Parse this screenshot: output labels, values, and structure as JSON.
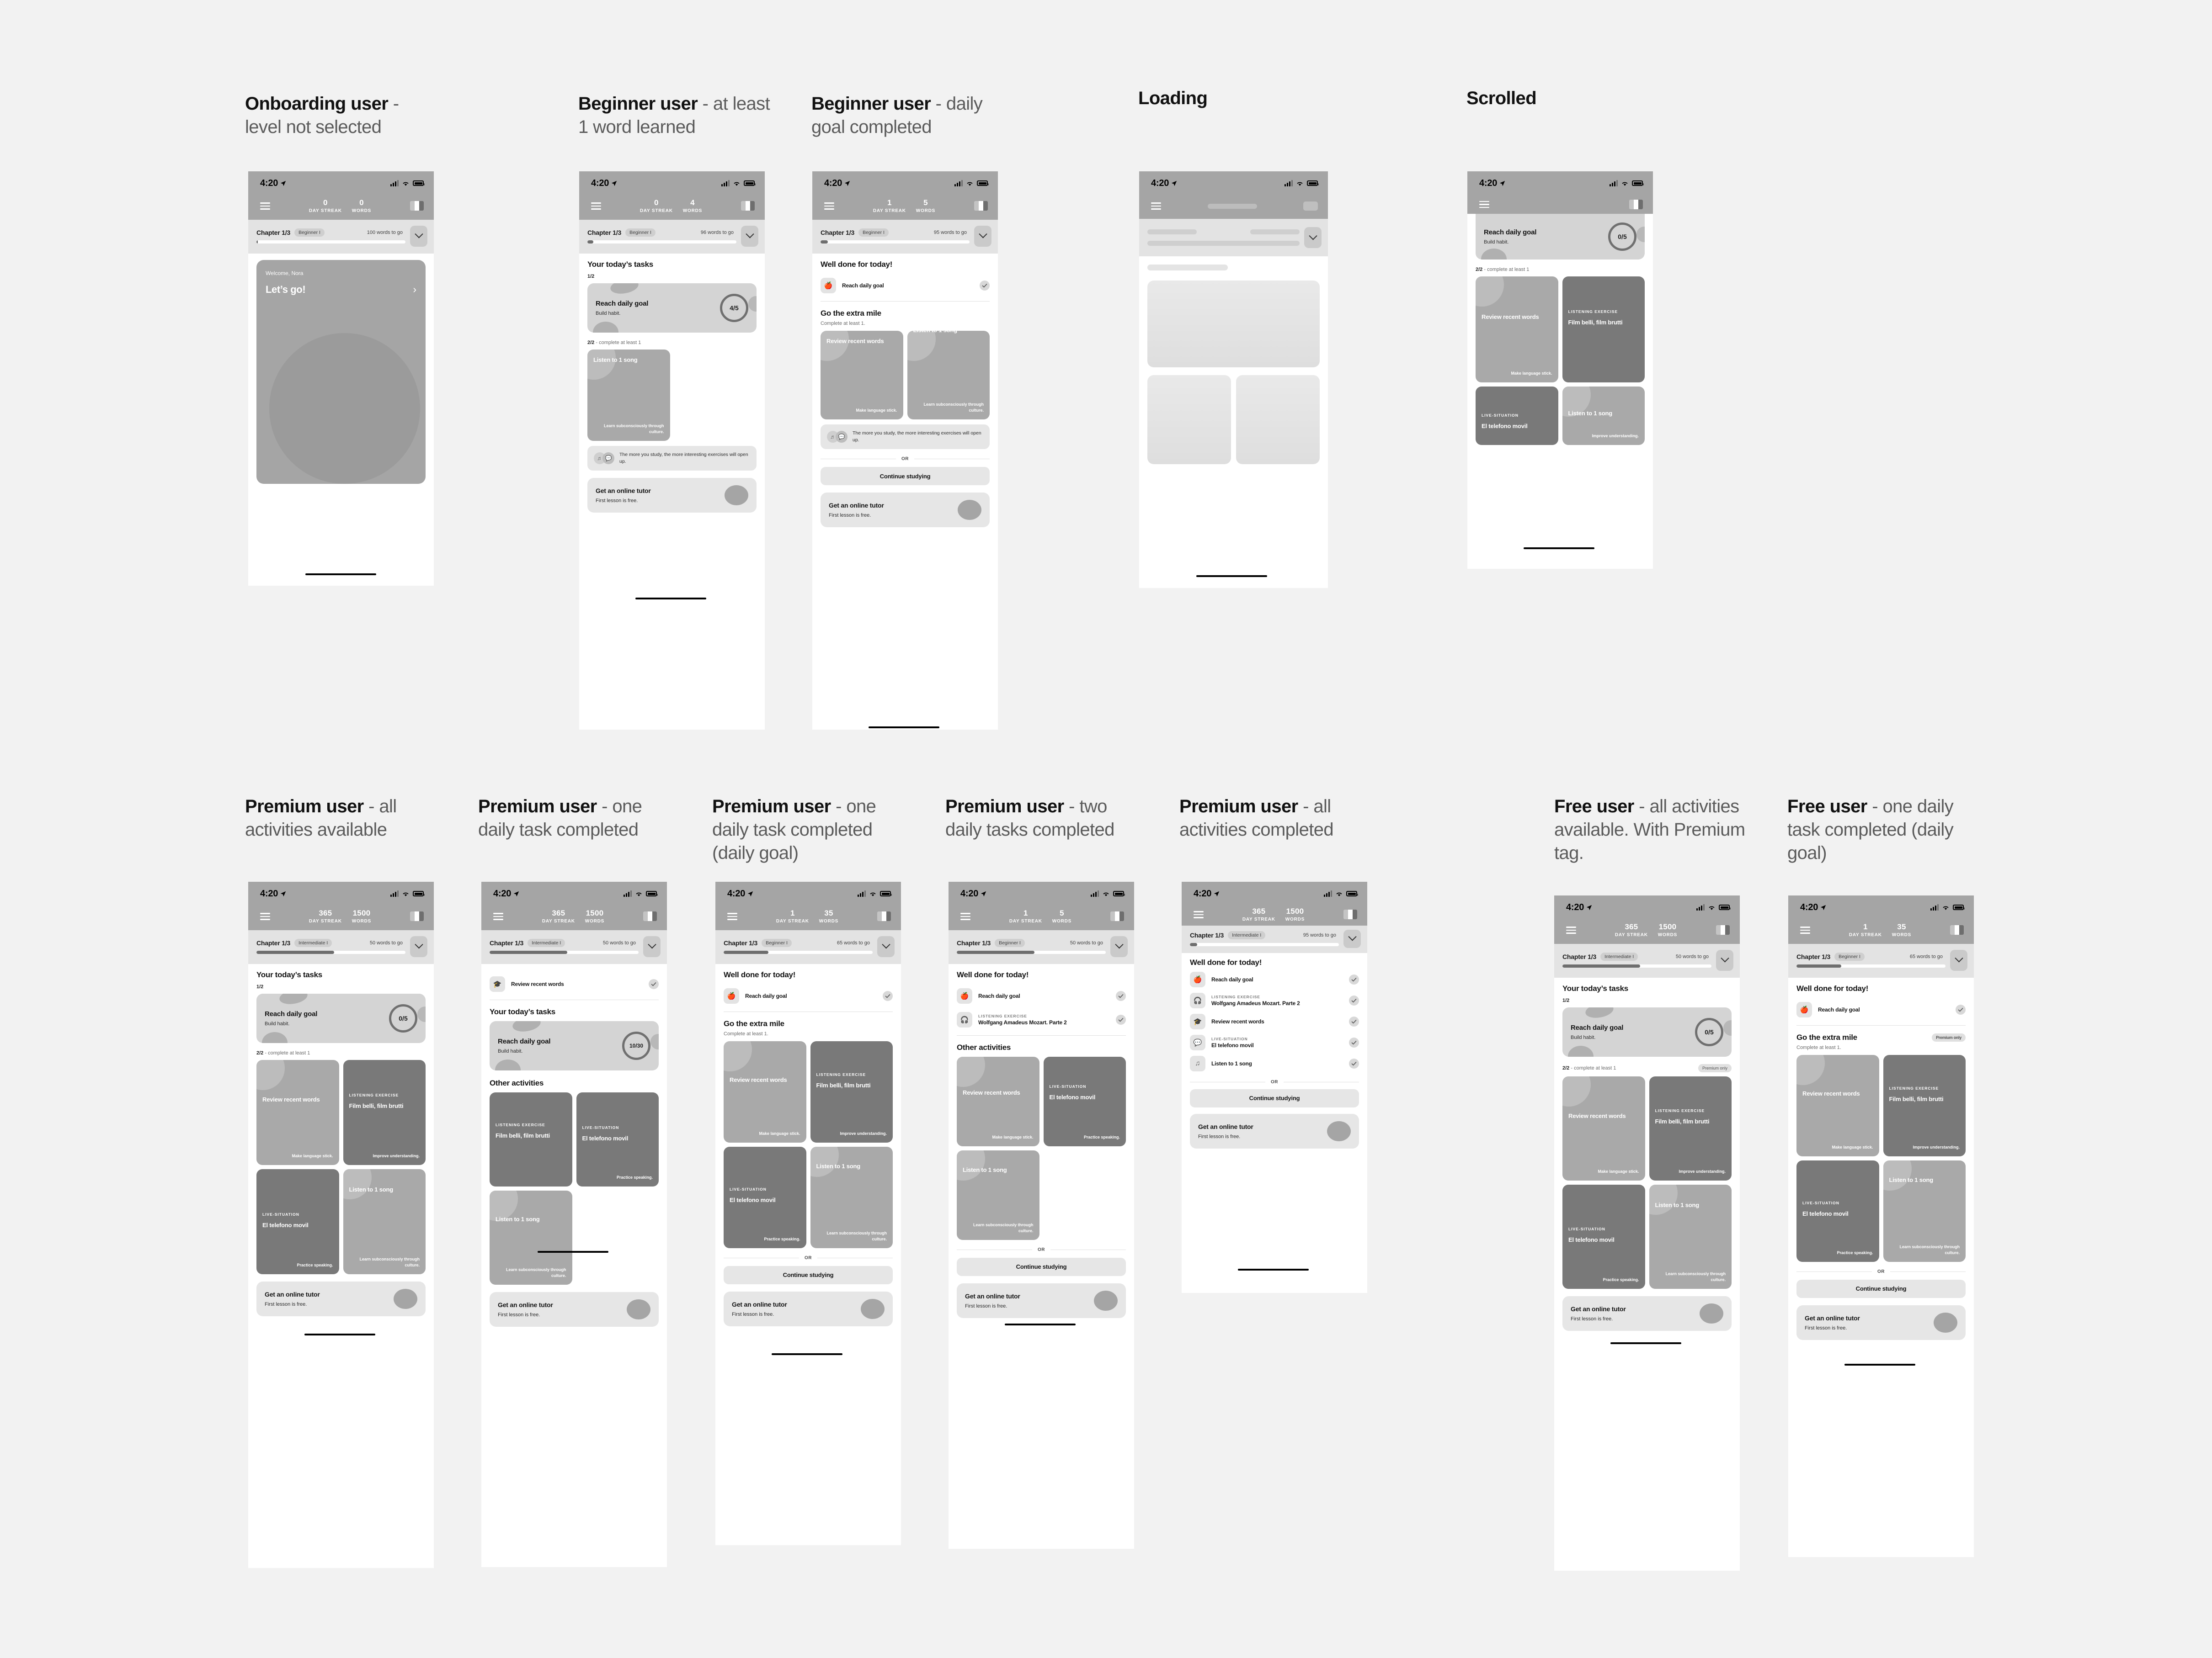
{
  "captions": {
    "onboarding": {
      "bold": "Onboarding user",
      "rest": " - level not selected"
    },
    "beginner_word": {
      "bold": "Beginner user",
      "rest": " - at least 1 word learned"
    },
    "beginner_goal": {
      "bold": "Beginner user",
      "rest": " - daily goal completed"
    },
    "loading": {
      "bold": "Loading",
      "rest": ""
    },
    "scrolled": {
      "bold": "Scrolled",
      "rest": ""
    },
    "prem_all": {
      "bold": "Premium user",
      "rest": " - all activities available"
    },
    "prem_one": {
      "bold": "Premium user",
      "rest": " - one daily task completed"
    },
    "prem_one_goal": {
      "bold": "Premium user",
      "rest": " - one daily task completed (daily goal)"
    },
    "prem_two": {
      "bold": "Premium user",
      "rest": " - two daily tasks completed"
    },
    "prem_done": {
      "bold": "Premium user",
      "rest": " - all activities completed"
    },
    "free_all": {
      "bold": "Free user",
      "rest": " - all activities available. With Premium tag."
    },
    "free_one_goal": {
      "bold": "Free user",
      "rest": " - one daily task completed (daily goal)"
    }
  },
  "status": {
    "time": "4:20"
  },
  "common": {
    "day_streak_label": "DAY STREAK",
    "words_label": "WORDS",
    "chapter": "Chapter 1/3",
    "todays_tasks": "Your today’s tasks",
    "well_done": "Well done for today!",
    "go_extra_mile": "Go the extra mile",
    "other_activities": "Other activities",
    "complete_at_least": "Complete at least 1.",
    "counter_1_2": "1/2",
    "counter_2_2_bold": "2/2",
    "counter_2_2_rest": " - complete at least 1",
    "or": "OR",
    "continue_studying": "Continue studying",
    "premium_only": "Premium only",
    "hint_text": "The more you study, the more interesting exercises will open up.",
    "goal_title": "Reach daily goal",
    "goal_sub": "Build habit.",
    "tutor_title": "Get an online tutor",
    "tutor_sub": "First lesson is free.",
    "welcome": "Welcome, Nora",
    "lets_go": "Let’s go!"
  },
  "activities": {
    "review": {
      "name": "Review recent words",
      "foot": "Make language stick.",
      "kicker": ""
    },
    "film": {
      "name": "Film belli, film brutti",
      "foot": "Improve understanding.",
      "kicker": "LISTENING EXERCISE"
    },
    "telefono": {
      "name": "El telefono movil",
      "foot": "Practice speaking.",
      "kicker": "LIVE-SITUATION"
    },
    "song": {
      "name": "Listen to 1 song",
      "foot": "Learn subconsciously through culture.",
      "kicker": ""
    },
    "mozart": {
      "name": "Wolfgang Amadeus Mozart. Parte 2",
      "kicker": "LISTENING EXERCISE"
    }
  },
  "screens": {
    "onboarding": {
      "streak": "0",
      "words": "0",
      "level": "Beginner I",
      "togo": "100 words to go",
      "progress": 0
    },
    "beginner_word": {
      "streak": "0",
      "words": "4",
      "level": "Beginner I",
      "togo": "96 words to go",
      "progress": 3,
      "goal": "4/5"
    },
    "beginner_goal": {
      "streak": "1",
      "words": "5",
      "level": "Beginner I",
      "togo": "95 words to go",
      "progress": 4
    },
    "scrolled": {
      "goal": "0/5"
    },
    "prem_all": {
      "streak": "365",
      "words": "1500",
      "level": "Intermediate I",
      "togo": "50 words to go",
      "progress": 52,
      "goal": "0/5"
    },
    "prem_one": {
      "streak": "365",
      "words": "1500",
      "level": "Intermediate I",
      "togo": "50 words to go",
      "progress": 52,
      "goal": "10/30"
    },
    "prem_one_goal": {
      "streak": "1",
      "words": "35",
      "level": "Beginner I",
      "togo": "65 words to go",
      "progress": 30
    },
    "prem_two": {
      "streak": "1",
      "words": "5",
      "level": "Beginner I",
      "togo": "50 words to go",
      "progress": 52
    },
    "prem_done": {
      "streak": "365",
      "words": "1500",
      "level": "Intermediate I",
      "togo": "95 words to go",
      "progress": 4
    },
    "free_all": {
      "streak": "365",
      "words": "1500",
      "level": "Intermediate I",
      "togo": "50 words to go",
      "progress": 52,
      "goal": "0/5"
    },
    "free_one_goal": {
      "streak": "1",
      "words": "35",
      "level": "Beginner I",
      "togo": "65 words to go",
      "progress": 30
    }
  },
  "colors": {
    "page_bg": "#f2f2f2",
    "appbar": "#a5a5a5",
    "chapterbar": "#e3e3e3",
    "tile_light": "#a9a9a9",
    "tile_dark": "#797979",
    "card_gray": "#d4d4d4",
    "soft_gray": "#e6e6e6"
  }
}
